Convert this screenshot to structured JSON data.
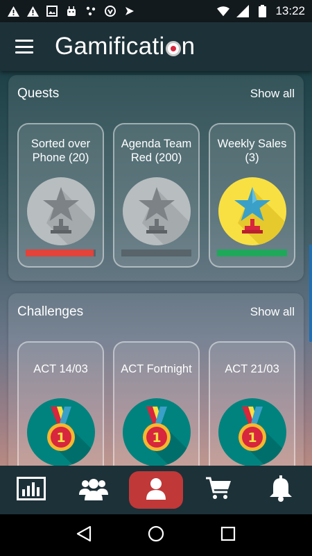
{
  "status_bar": {
    "time": "13:22",
    "left_icons": [
      "warning-icon",
      "warning-icon",
      "image-icon",
      "android-icon",
      "dots-icon",
      "shield-icon",
      "send-icon"
    ],
    "right_icons": [
      "wifi-icon",
      "signal-icon",
      "battery-icon"
    ]
  },
  "app_bar": {
    "title_before": "Gamificati",
    "title_after": "n",
    "menu_icon": "menu-icon"
  },
  "quests": {
    "title": "Quests",
    "show_all": "Show all",
    "cards": [
      {
        "label": "Sorted over Phone (20)",
        "badge": "grey-trophy",
        "progress": 0.97,
        "progress_color": "#e2433b"
      },
      {
        "label": "Agenda Team Red (200)",
        "badge": "grey-trophy",
        "progress": 0,
        "progress_color": "#58636a"
      },
      {
        "label": "Weekly Sales (3)",
        "badge": "gold-trophy",
        "progress": 1.0,
        "progress_color": "#1fa85a"
      }
    ]
  },
  "challenges": {
    "title": "Challenges",
    "show_all": "Show all",
    "cards": [
      {
        "label": "ACT 14/03",
        "badge": "medal-icon",
        "medal_number": "1"
      },
      {
        "label": "ACT Fortnight",
        "badge": "medal-icon",
        "medal_number": "1"
      },
      {
        "label": "ACT 21/03",
        "badge": "medal-icon",
        "medal_number": "1"
      }
    ]
  },
  "bottom_nav": {
    "items": [
      "stats-icon",
      "team-icon",
      "profile-icon",
      "cart-icon",
      "bell-icon"
    ],
    "active": "profile-icon",
    "active_color": "#c03838"
  },
  "system_nav": [
    "back-icon",
    "home-icon",
    "recents-icon"
  ],
  "colors": {
    "app_bar": "#1d3138",
    "gold": "#f8e043",
    "teal": "#00837e",
    "red": "#e2433b",
    "green": "#1fa85a"
  }
}
